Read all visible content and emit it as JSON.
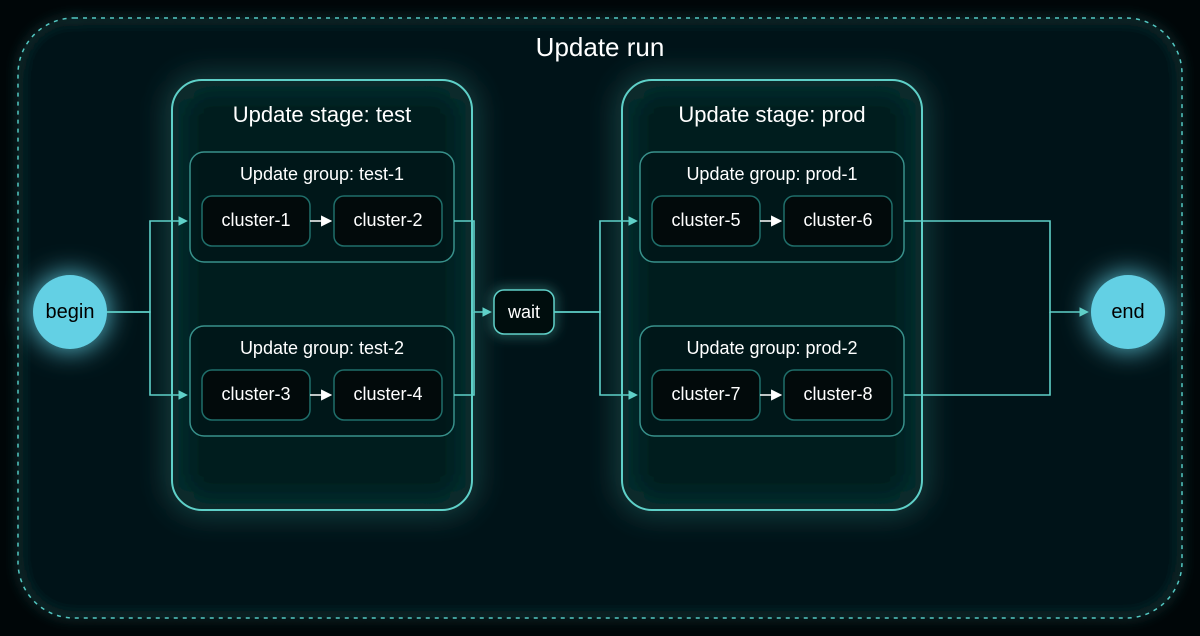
{
  "run": {
    "title": "Update run",
    "begin_label": "begin",
    "end_label": "end",
    "wait_label": "wait",
    "stages": [
      {
        "title": "Update stage: test",
        "groups": [
          {
            "title": "Update group: test-1",
            "clusters": [
              "cluster-1",
              "cluster-2"
            ]
          },
          {
            "title": "Update group: test-2",
            "clusters": [
              "cluster-3",
              "cluster-4"
            ]
          }
        ]
      },
      {
        "title": "Update stage: prod",
        "groups": [
          {
            "title": "Update group: prod-1",
            "clusters": [
              "cluster-5",
              "cluster-6"
            ]
          },
          {
            "title": "Update group: prod-2",
            "clusters": [
              "cluster-7",
              "cluster-8"
            ]
          }
        ]
      }
    ]
  },
  "colors": {
    "accent": "#5fd0c8",
    "accent_dim": "#2f7a75",
    "begin_fill": "#64d0e4",
    "end_fill": "#64d0e4",
    "cluster_stroke": "#1f6e6a"
  }
}
